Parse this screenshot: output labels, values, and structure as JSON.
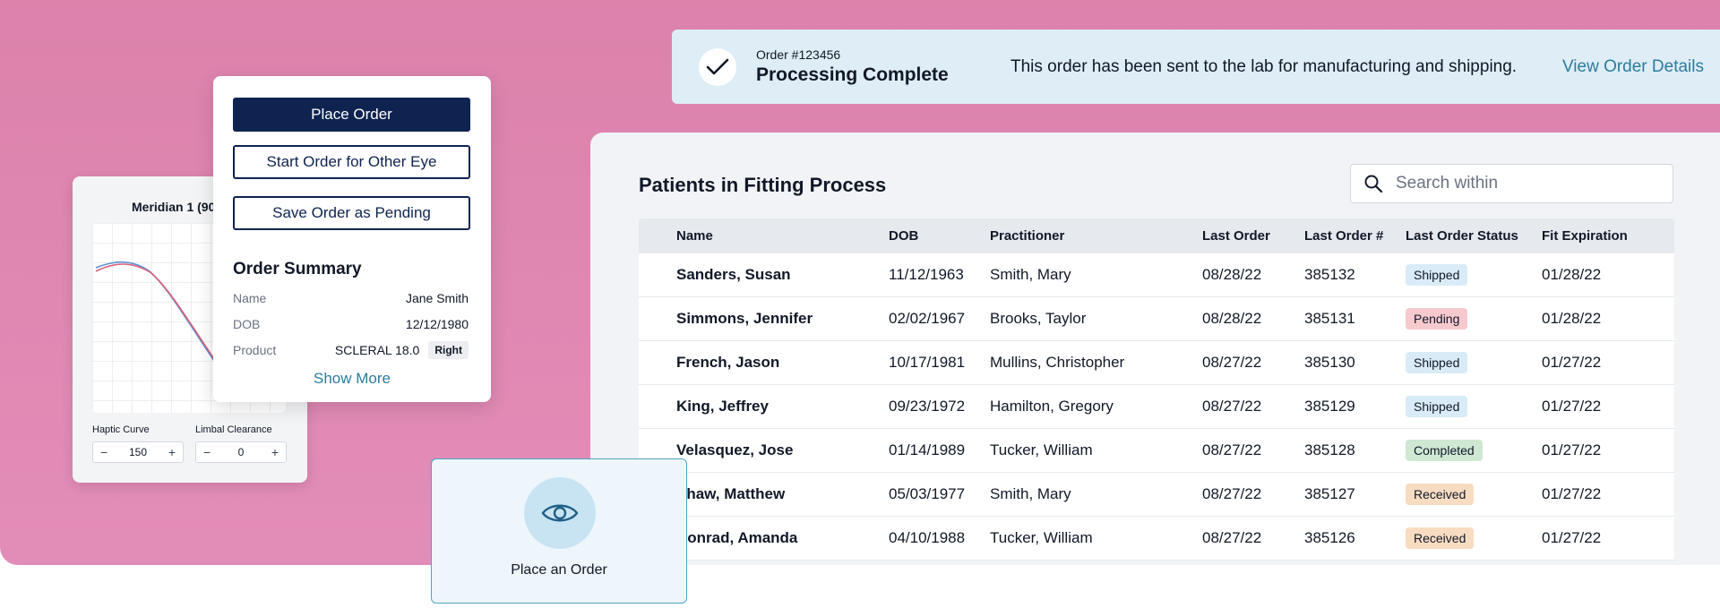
{
  "colors": {
    "background_pink": "#dc82ab",
    "navy": "#0e2350",
    "link_teal": "#2c7c9c",
    "banner_bg": "#deedf6",
    "series_blue": "#5b8fd6",
    "series_red": "#d9607a"
  },
  "banner": {
    "order_number": "Order #123456",
    "title": "Processing Complete",
    "message": "This order has been sent to the lab for manufacturing and shipping.",
    "link": "View Order Details",
    "icon": "check-icon"
  },
  "patients": {
    "title": "Patients in Fitting Process",
    "search_placeholder": "Search within",
    "columns": [
      "Name",
      "DOB",
      "Practitioner",
      "Last Order",
      "Last Order #",
      "Last Order Status",
      "Fit Expiration"
    ],
    "rows": [
      {
        "name": "Sanders, Susan",
        "dob": "11/12/1963",
        "practitioner": "Smith, Mary",
        "last_order": "08/28/22",
        "order_no": "385132",
        "status": "Shipped",
        "status_color": "#d9ebf7",
        "fit_exp": "01/28/22"
      },
      {
        "name": "Simmons, Jennifer",
        "dob": "02/02/1967",
        "practitioner": "Brooks, Taylor",
        "last_order": "08/28/22",
        "order_no": "385131",
        "status": "Pending",
        "status_color": "#f6c9cd",
        "fit_exp": "01/28/22"
      },
      {
        "name": "French, Jason",
        "dob": "10/17/1981",
        "practitioner": "Mullins, Christopher",
        "last_order": "08/27/22",
        "order_no": "385130",
        "status": "Shipped",
        "status_color": "#d9ebf7",
        "fit_exp": "01/27/22"
      },
      {
        "name": "King, Jeffrey",
        "dob": "09/23/1972",
        "practitioner": "Hamilton, Gregory",
        "last_order": "08/27/22",
        "order_no": "385129",
        "status": "Shipped",
        "status_color": "#d9ebf7",
        "fit_exp": "01/27/22"
      },
      {
        "name": "Velasquez, Jose",
        "dob": "01/14/1989",
        "practitioner": "Tucker, William",
        "last_order": "08/27/22",
        "order_no": "385128",
        "status": "Completed",
        "status_color": "#cfe8d4",
        "fit_exp": "01/27/22"
      },
      {
        "name": "Shaw, Matthew",
        "dob": "05/03/1977",
        "practitioner": "Smith, Mary",
        "last_order": "08/27/22",
        "order_no": "385127",
        "status": "Received",
        "status_color": "#f8dcc2",
        "fit_exp": "01/27/22"
      },
      {
        "name": "Conrad, Amanda",
        "dob": "04/10/1988",
        "practitioner": "Tucker, William",
        "last_order": "08/27/22",
        "order_no": "385126",
        "status": "Received",
        "status_color": "#f8dcc2",
        "fit_exp": "01/27/22"
      }
    ]
  },
  "meridian": {
    "title": "Meridian 1 (90",
    "haptic_label": "Haptic Curve",
    "haptic_value": "150",
    "limbal_label": "Limbal Clearance",
    "limbal_value": "0"
  },
  "order": {
    "place_button": "Place Order",
    "other_eye_button": "Start Order for Other Eye",
    "pending_button": "Save Order as Pending",
    "summary_title": "Order Summary",
    "fields": [
      {
        "label": "Name",
        "value": "Jane Smith"
      },
      {
        "label": "DOB",
        "value": "12/12/1980"
      },
      {
        "label": "Product",
        "value": "SCLERAL 18.0",
        "tag": "Right"
      }
    ],
    "show_more": "Show More"
  },
  "place_tile": {
    "label": "Place an Order",
    "icon": "eye-icon"
  }
}
